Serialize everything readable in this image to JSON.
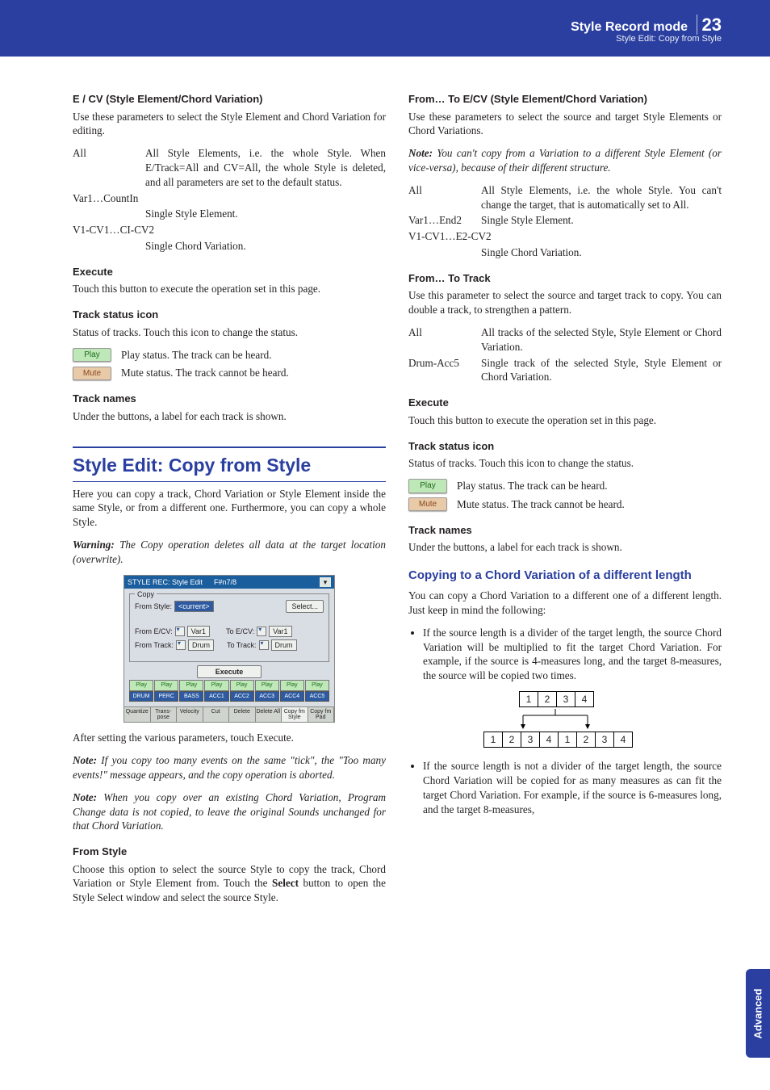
{
  "header": {
    "title": "Style Record mode",
    "subtitle": "Style Edit: Copy from Style",
    "page_number": "23",
    "side_tab": "Advanced"
  },
  "left": {
    "h_ecv": "E / CV (Style Element/Chord Variation)",
    "p_ecv": "Use these parameters to select the Style Element and Chord Variation for editing.",
    "ecv_rows": [
      {
        "term": "All",
        "desc": "All Style Elements, i.e. the whole Style. When E/Track=All and CV=All, the whole Style is deleted, and all parameters are set to the default status."
      },
      {
        "term": "Var1…CountIn",
        "desc": ""
      },
      {
        "term": "",
        "desc": "Single Style Element."
      },
      {
        "term": "V1-CV1…CI-CV2",
        "desc": ""
      },
      {
        "term": "",
        "desc": "Single Chord Variation."
      }
    ],
    "h_exec": "Execute",
    "p_exec": "Touch this button to execute the operation set in this page.",
    "h_tsi": "Track status icon",
    "p_tsi": "Status of tracks. Touch this icon to change the status.",
    "play_label": "Play",
    "play_desc": "Play status. The track can be heard.",
    "mute_label": "Mute",
    "mute_desc": "Mute status. The track cannot be heard.",
    "h_tn": "Track names",
    "p_tn": "Under the buttons, a label for each track is shown.",
    "section_title": "Style Edit: Copy from Style",
    "p_intro": "Here you can copy a track, Chord Variation or Style Element inside the same Style, or from a different one. Furthermore, you can copy a whole Style.",
    "warning_label": "Warning:",
    "warning_text": " The Copy operation deletes all data at the target location (overwrite).",
    "p_after": "After setting the various parameters, touch Execute.",
    "note1_label": "Note:",
    "note1_text": " If you copy too many events on the same \"tick\", the \"Too many events!\" message appears, and the copy operation is aborted.",
    "note2_label": "Note:",
    "note2_text": " When you copy over an existing Chord Variation, Program Change data is not copied, to leave the original Sounds unchanged for that Chord Variation.",
    "h_fs": "From Style",
    "p_fs1": "Choose this option to select the source Style to copy the track, Chord Variation or Style Element from. Touch the ",
    "p_fs_bold": "Select",
    "p_fs2": " button to open the Style Select window and select the source Style."
  },
  "shot": {
    "title": "STYLE REC: Style Edit",
    "tempo": "F#n7/8",
    "legend": "Copy",
    "from_style_lbl": "From Style:",
    "from_style_val": "<current>",
    "select_btn": "Select...",
    "from_ecv_lbl": "From E/CV:",
    "from_ecv_val": "Var1",
    "to_ecv_lbl": "To E/CV:",
    "to_ecv_val": "Var1",
    "from_track_lbl": "From Track:",
    "from_track_val": "Drum",
    "to_track_lbl": "To Track:",
    "to_track_val": "Drum",
    "execute": "Execute",
    "play": "Play",
    "tracks": [
      "DRUM",
      "PERC",
      "BASS",
      "ACC1",
      "ACC2",
      "ACC3",
      "ACC4",
      "ACC5"
    ],
    "tabs": [
      "Quantize",
      "Trans-\npose",
      "Velocity",
      "Cut",
      "Delete",
      "Delete\nAll",
      "Copy fm\nStyle",
      "Copy fm\nPad"
    ]
  },
  "right": {
    "h_ftecv": "From… To E/CV (Style Element/Chord Variation)",
    "p_ftecv": "Use these parameters to select the source and target Style Elements or Chord Variations.",
    "note_label": "Note:",
    "note_text": " You can't copy from a Variation to a different Style Element (or vice-versa), because of their different structure.",
    "ecv_rows": [
      {
        "term": "All",
        "desc": "All Style Elements, i.e. the whole Style. You can't change the target, that is automatically set to All."
      },
      {
        "term": "Var1…End2",
        "desc": "Single Style Element."
      },
      {
        "term": "V1-CV1…E2-CV2",
        "desc": ""
      },
      {
        "term": "",
        "desc": "Single Chord Variation."
      }
    ],
    "h_ftt": "From… To Track",
    "p_ftt": "Use this parameter to select the source and target track to copy. You can double a track, to strengthen a pattern.",
    "ftt_rows": [
      {
        "term": "All",
        "desc": "All tracks of the selected Style, Style Element or Chord Variation."
      },
      {
        "term": "Drum-Acc5",
        "desc": "Single track of the selected Style, Style Element or Chord Variation."
      }
    ],
    "h_exec": "Execute",
    "p_exec": "Touch this button to execute the operation set in this page.",
    "h_tsi": "Track status icon",
    "p_tsi": "Status of tracks. Touch this icon to change the status.",
    "play_label": "Play",
    "play_desc": "Play status. The track can be heard.",
    "mute_label": "Mute",
    "mute_desc": "Mute status. The track cannot be heard.",
    "h_tn": "Track names",
    "p_tn": "Under the buttons, a label for each track is shown.",
    "sub_title": "Copying to a Chord Variation of a different length",
    "p_sub": "You can copy a Chord Variation to a different one of a different length. Just keep in mind the following:",
    "bul1": "If the source length is a divider of the target length, the source Chord Variation will be multiplied to fit the target Chord Variation. For example, if the source is 4-measures long, and the target 8-measures, the source will be copied two times.",
    "bul2": "If the source length is not a divider of the target length, the source Chord Variation will be copied for as many measures as can fit the target Chord Variation. For example, if the source is 6-measures long, and the target 8-measures,",
    "diagram_top": [
      "1",
      "2",
      "3",
      "4"
    ],
    "diagram_bottom": [
      "1",
      "2",
      "3",
      "4",
      "1",
      "2",
      "3",
      "4"
    ]
  }
}
